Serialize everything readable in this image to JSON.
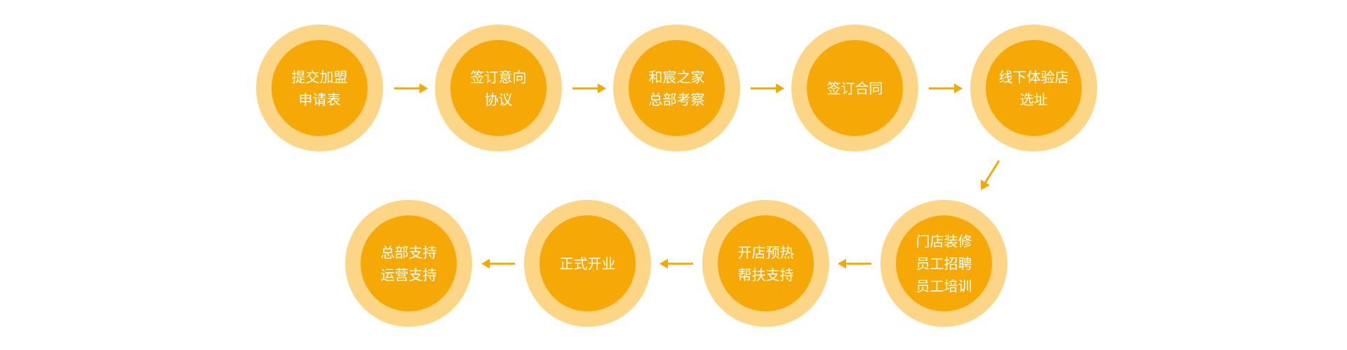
{
  "colors": {
    "outer_ring": "#FCD586",
    "inner_circle": "#F6A906",
    "arrow": "#F3A806",
    "text": "#FFFFFF"
  },
  "steps": [
    {
      "lines": [
        "提交加盟",
        "申请表"
      ]
    },
    {
      "lines": [
        "签订意向",
        "协议"
      ]
    },
    {
      "lines": [
        "和宸之家",
        "总部考察"
      ]
    },
    {
      "lines": [
        "签订合同"
      ]
    },
    {
      "lines": [
        "线下体验店",
        "选址"
      ]
    },
    {
      "lines": [
        "门店装修",
        "员工招聘",
        "员工培训"
      ]
    },
    {
      "lines": [
        "开店预热",
        "帮扶支持"
      ]
    },
    {
      "lines": [
        "正式开业"
      ]
    },
    {
      "lines": [
        "总部支持",
        "运营支持"
      ]
    }
  ],
  "arrows": [
    {
      "direction": "right"
    },
    {
      "direction": "right"
    },
    {
      "direction": "right"
    },
    {
      "direction": "right"
    },
    {
      "direction": "down-left"
    },
    {
      "direction": "left"
    },
    {
      "direction": "left"
    },
    {
      "direction": "left"
    }
  ]
}
